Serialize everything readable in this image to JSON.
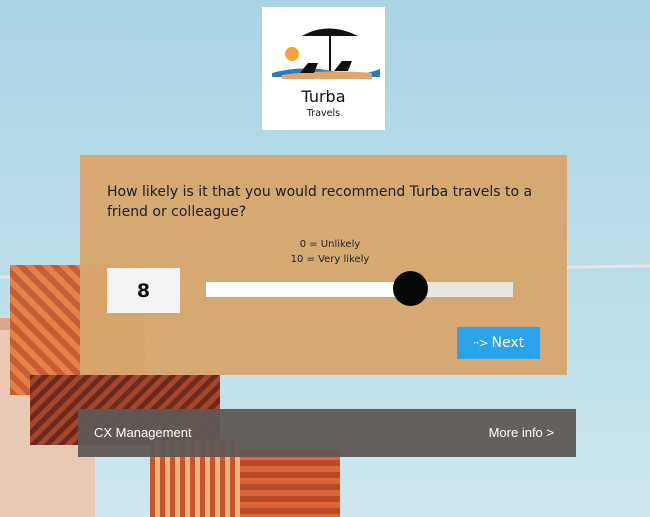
{
  "logo": {
    "name": "Turba",
    "tagline": "Travels",
    "icon": "beach-umbrella-loungers-icon"
  },
  "survey": {
    "question": "How likely is it that you would recommend Turba travels to a friend or colleague?",
    "scale_low": "0 = Unlikely",
    "scale_high": "10 = Very likely",
    "score": "8",
    "slider_value": 8,
    "slider_max": 10,
    "next_icon": "arrow-right-icon",
    "next_glyph": "··>",
    "next_label": "Next",
    "colors": {
      "card": "#d6a76c",
      "button": "#2aa3ea",
      "thumb": "#070707"
    }
  },
  "footer": {
    "left_label": "CX Management",
    "right_label": "More info >",
    "color": "#5f5856"
  }
}
